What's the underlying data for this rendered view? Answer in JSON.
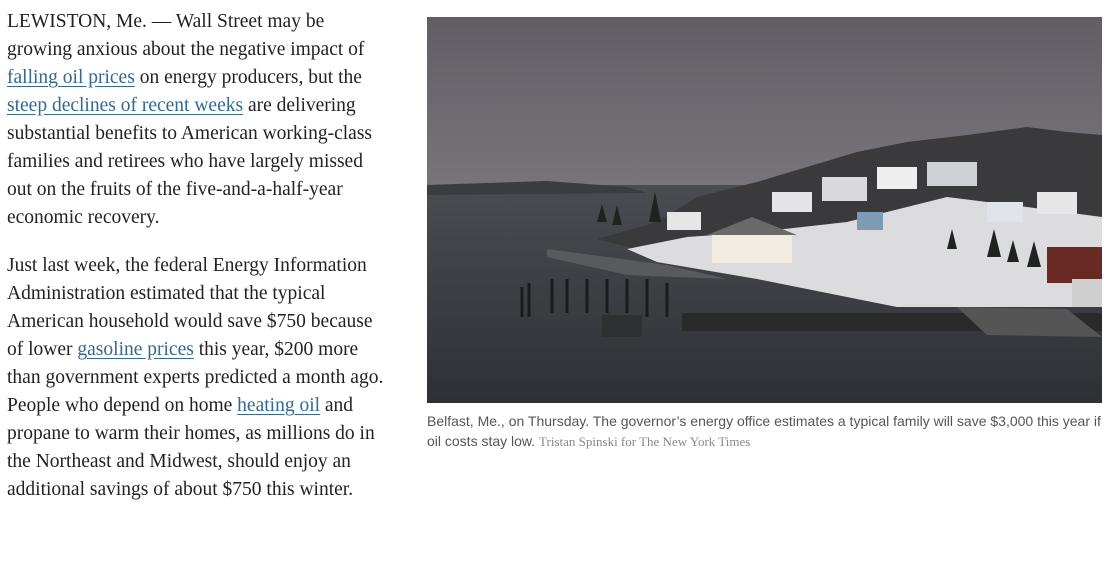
{
  "article": {
    "p1": {
      "t1": "LEWISTON, Me. — Wall Street may be growing anxious about the negative impact of ",
      "link1": "falling oil prices",
      "t2": " on energy producers, but the ",
      "link2": "steep declines of recent weeks",
      "t3": " are delivering substantial benefits to American working-class families and retirees who have largely missed out on the fruits of the five-and-a-half-year economic recovery."
    },
    "p2": {
      "t1": "Just last week, the federal Energy Information Administration estimated that the typical American household would save $750 because of lower ",
      "link1": "gasoline prices",
      "t2": " this year, $200 more than government experts predicted a month ago. People who depend on home ",
      "link2": "heating oil",
      "t3": " and propane to warm their homes, as millions do in the Northeast and Midwest, should enjoy an additional savings of about $750 this winter."
    }
  },
  "figure": {
    "caption": "Belfast, Me., on Thursday. The governor’s energy office estimates a typical family will save $3,000 this year if oil costs stay low.",
    "credit": "Tristan Spinski for The New York Times",
    "colors": {
      "sky": "#6c6a6f",
      "water": "#35383d",
      "snow": "#e6e6e6"
    }
  }
}
